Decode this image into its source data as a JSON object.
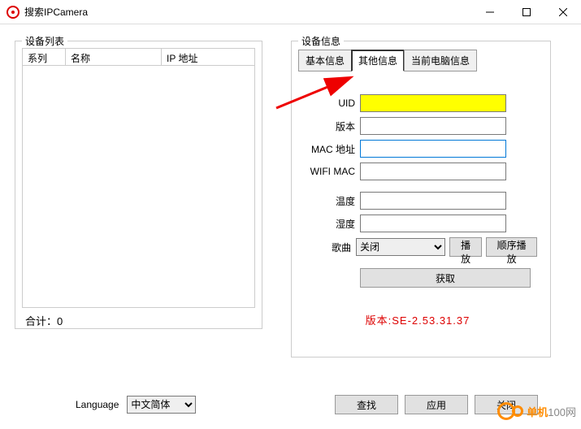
{
  "window": {
    "title": "搜索IPCamera"
  },
  "left": {
    "legend": "设备列表",
    "columns": {
      "series": "系列",
      "name": "名称",
      "ip": "IP 地址"
    },
    "total_label": "合计：",
    "total_value": "0"
  },
  "right": {
    "legend": "设备信息",
    "tabs": {
      "basic": "基本信息",
      "other": "其他信息",
      "pc": "当前电脑信息"
    },
    "fields": {
      "uid": "UID",
      "version": "版本",
      "mac": "MAC 地址",
      "wifimac": "WIFI MAC",
      "temp": "温度",
      "humid": "湿度",
      "song": "歌曲"
    },
    "song_select": "关闭",
    "play": "播放",
    "seqplay": "顺序播放",
    "fetch": "获取",
    "version_text": "版本:SE-2.53.31.37"
  },
  "footer": {
    "lang_label": "Language",
    "lang_value": "中文简体",
    "search": "查找",
    "apply": "应用",
    "close": "关闭"
  },
  "watermark": {
    "brand": "单机",
    "suffix": "100网"
  }
}
